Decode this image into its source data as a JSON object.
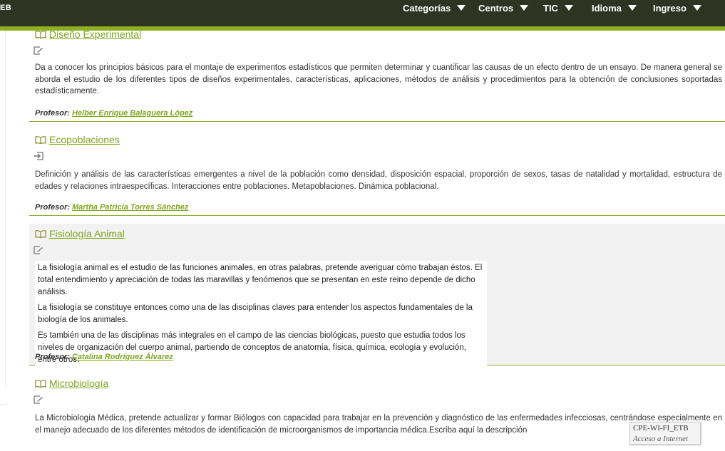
{
  "header": {
    "brand_fragment": "EB",
    "nav": [
      {
        "label": "Categorías"
      },
      {
        "label": "Centros"
      },
      {
        "label": "TIC"
      },
      {
        "label": "Idioma"
      },
      {
        "label": "Ingreso"
      }
    ]
  },
  "courses": [
    {
      "title": "Diseño Experimental",
      "description": "Da a conocer los principios básicos para el montaje de experimentos estadísticos que permiten determinar y cuantificar las causas de un efecto dentro de un ensayo. De manera general se aborda el estudio de los diferentes tipos de diseños experimentales, características, aplicaciones, métodos de análisis y procedimientos para la obtención de conclusiones soportadas estadísticamente.",
      "professor_label": "Profesor:",
      "professor": "Helber Enrique Balaguera López"
    },
    {
      "title": "Ecopoblaciones",
      "description": "Definición y análisis de las características emergentes a nivel de la población como densidad, disposición espacial, proporción de sexos, tasas de natalidad y mortalidad, estructura de edades y relaciones intraespecíficas. Interacciones entre poblaciones. Metapoblaciones. Dinámica poblacional.",
      "professor_label": "Profesor:",
      "professor": "Martha Patricia Torres Sánchez"
    },
    {
      "title": "Fisiología Animal",
      "paragraphs": [
        "La fisiología animal es el estudio de las funciones animales, en otras palabras, pretende averiguar cómo trabajan éstos. El total entendimiento y apreciación de todas las maravillas y fenómenos que se presentan en este reino depende de dicho análisis.",
        "La fisiología se constituye entonces como una de las disciplinas claves para entender los aspectos fundamentales de la biología de los animales.",
        "Es también una de las disciplinas más integrales en el campo de las ciencias biológicas, puesto que estudia todos los niveles de organización del cuerpo animal, partiendo de conceptos de anatomía, física, química, ecología y evolución, entre otros."
      ],
      "professor_label": "Profesor:",
      "professor": "Catalina Rodríguez Álvarez"
    },
    {
      "title": "Microbiología",
      "description": "La Microbiología Médica, pretende actualizar y formar Biólogos con capacidad para trabajar  en la prevención y diagnóstico de las enfermedades infecciosas, centrándose especialmente en el manejo adecuado de los diferentes métodos de identificación de microorganismos de importancia médica.Escriba aquí la descripción"
    }
  ],
  "tooltip": {
    "network": "CPE-WI-FI_ETB",
    "status": "Acceso a Internet"
  },
  "colors": {
    "topbar": "#2f3322",
    "accent": "#8db021",
    "link": "#7ea51c"
  }
}
